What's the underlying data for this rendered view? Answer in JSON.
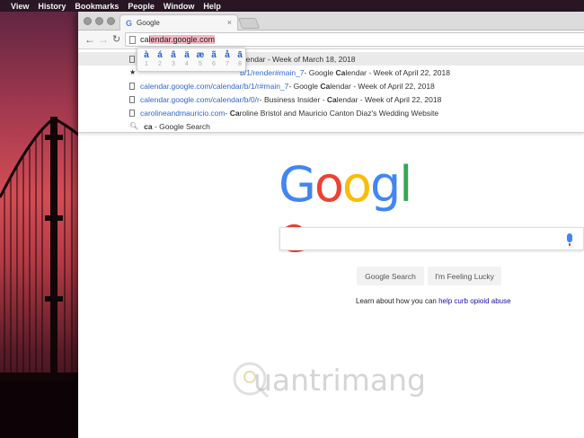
{
  "menubar": {
    "items": [
      "View",
      "History",
      "Bookmarks",
      "People",
      "Window",
      "Help"
    ]
  },
  "browser": {
    "tab_title": "Google",
    "tab_close": "×",
    "omnibox": {
      "typed": "ca",
      "completion": "lendar.google.com"
    },
    "accent_popup": {
      "chars": [
        "à",
        "á",
        "â",
        "ä",
        "æ",
        "ã",
        "å",
        "ā"
      ],
      "numbers": [
        "1",
        "2",
        "3",
        "4",
        "5",
        "6",
        "7",
        "8"
      ]
    },
    "suggestions": [
      {
        "icon": "page-icon",
        "url": "",
        "text_bold": "Ca",
        "text": "lendar - Week of March 18, 2018"
      },
      {
        "icon": "star-icon",
        "url": "calendar.google.com/calendar/b/1/render#main_7",
        "text_pre": " - Google ",
        "text_bold": "Ca",
        "text": "lendar - Week of April 22, 2018"
      },
      {
        "icon": "page-icon",
        "url": "calendar.google.com/calendar/b/1/r#main_7",
        "text_pre": " - Google ",
        "text_bold": "Ca",
        "text": "lendar - Week of April 22, 2018"
      },
      {
        "icon": "page-icon",
        "url": "calendar.google.com/calendar/b/0/r",
        "text_pre": " - Business Insider - ",
        "text_bold": "Ca",
        "text": "lendar - Week of April 22, 2018"
      },
      {
        "icon": "page-icon",
        "url": "carolineandmauricio.com",
        "text_pre": " - ",
        "text_bold": "Ca",
        "text": "roline Bristol and Mauricio Canton Diaz's Wedding Website"
      },
      {
        "icon": "search-icon",
        "url": "",
        "text_bold": "ca",
        "text": " - Google Search"
      }
    ]
  },
  "google": {
    "logo_letters": [
      "G",
      "o",
      "o",
      "g",
      "l",
      "e"
    ],
    "logo_colors": [
      "#4285f4",
      "#ea4335",
      "#fbbc05",
      "#4285f4",
      "#34a853",
      "#ea4335"
    ],
    "search_button": "Google Search",
    "lucky_button": "I'm Feeling Lucky",
    "learn_text": "Learn about how you can ",
    "learn_link": "help curb opioid abuse"
  },
  "watermark": {
    "text": "uantrimang"
  }
}
